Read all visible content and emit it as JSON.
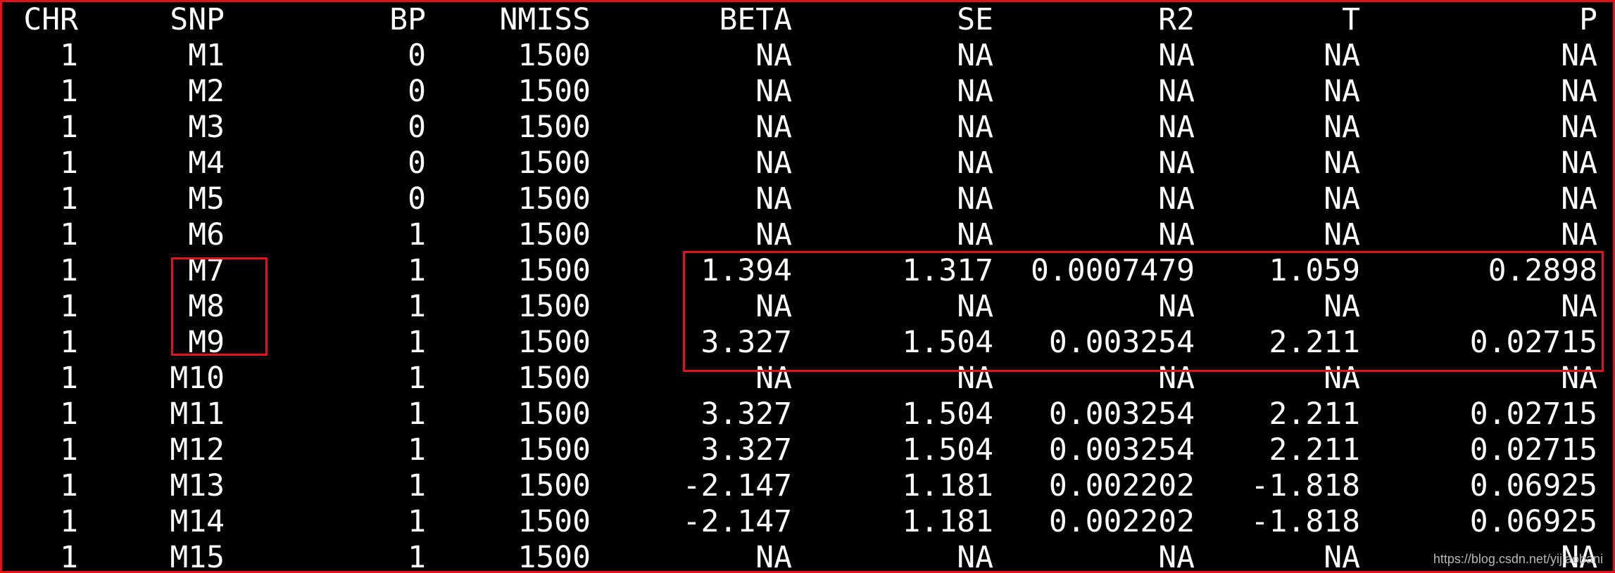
{
  "columns": [
    "CHR",
    "SNP",
    "BP",
    "NMISS",
    "BETA",
    "SE",
    "R2",
    "T",
    "P"
  ],
  "rows": [
    [
      "1",
      "M1",
      "0",
      "1500",
      "NA",
      "NA",
      "NA",
      "NA",
      "NA"
    ],
    [
      "1",
      "M2",
      "0",
      "1500",
      "NA",
      "NA",
      "NA",
      "NA",
      "NA"
    ],
    [
      "1",
      "M3",
      "0",
      "1500",
      "NA",
      "NA",
      "NA",
      "NA",
      "NA"
    ],
    [
      "1",
      "M4",
      "0",
      "1500",
      "NA",
      "NA",
      "NA",
      "NA",
      "NA"
    ],
    [
      "1",
      "M5",
      "0",
      "1500",
      "NA",
      "NA",
      "NA",
      "NA",
      "NA"
    ],
    [
      "1",
      "M6",
      "1",
      "1500",
      "NA",
      "NA",
      "NA",
      "NA",
      "NA"
    ],
    [
      "1",
      "M7",
      "1",
      "1500",
      "1.394",
      "1.317",
      "0.0007479",
      "1.059",
      "0.2898"
    ],
    [
      "1",
      "M8",
      "1",
      "1500",
      "NA",
      "NA",
      "NA",
      "NA",
      "NA"
    ],
    [
      "1",
      "M9",
      "1",
      "1500",
      "3.327",
      "1.504",
      "0.003254",
      "2.211",
      "0.02715"
    ],
    [
      "1",
      "M10",
      "1",
      "1500",
      "NA",
      "NA",
      "NA",
      "NA",
      "NA"
    ],
    [
      "1",
      "M11",
      "1",
      "1500",
      "3.327",
      "1.504",
      "0.003254",
      "2.211",
      "0.02715"
    ],
    [
      "1",
      "M12",
      "1",
      "1500",
      "3.327",
      "1.504",
      "0.003254",
      "2.211",
      "0.02715"
    ],
    [
      "1",
      "M13",
      "1",
      "1500",
      "-2.147",
      "1.181",
      "0.002202",
      "-1.818",
      "0.06925"
    ],
    [
      "1",
      "M14",
      "1",
      "1500",
      "-2.147",
      "1.181",
      "0.002202",
      "-1.818",
      "0.06925"
    ],
    [
      "1",
      "M15",
      "1",
      "1500",
      "NA",
      "NA",
      "NA",
      "NA",
      "NA"
    ]
  ],
  "watermark": "https://blog.csdn.net/yijiaobani",
  "colors": {
    "background": "#000000",
    "text": "#ffffff",
    "annotation_border": "#e0141a"
  }
}
